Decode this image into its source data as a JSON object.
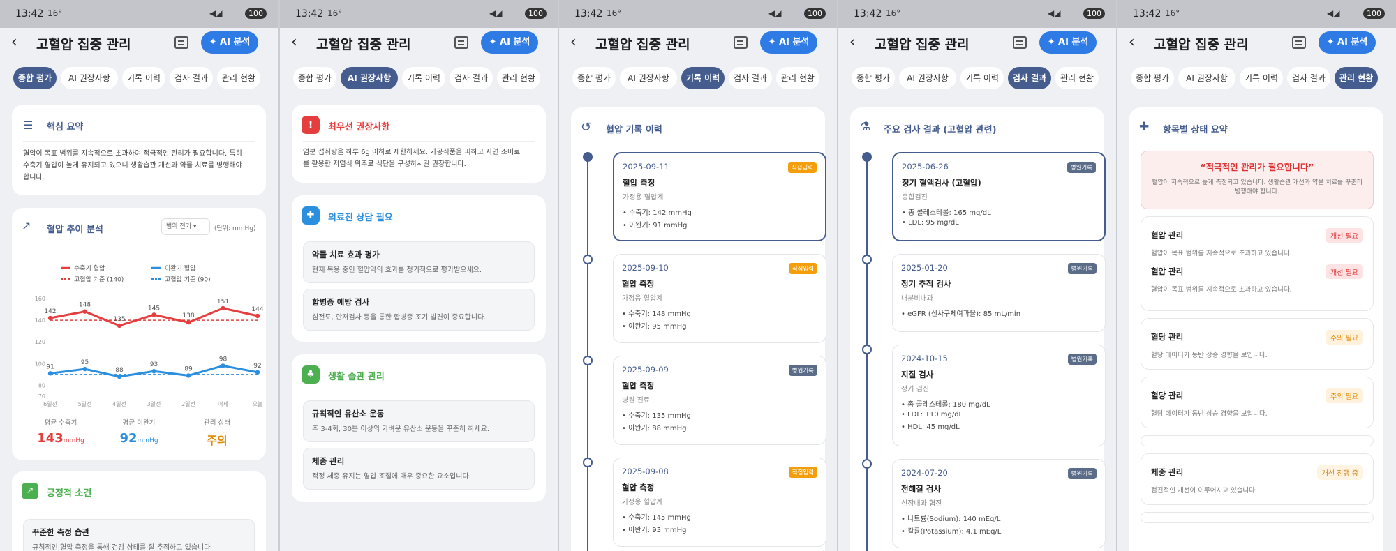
{
  "status": {
    "time": "13:42",
    "temp": "16°",
    "battery": "100"
  },
  "app": {
    "title": "고혈압 집중 관리",
    "ai_button": "AI 분석"
  },
  "tabs": [
    "종합 평가",
    "AI 권장사항",
    "기록 이력",
    "검사 결과",
    "관리 현황"
  ],
  "colors": {
    "primary": "#445c8e",
    "accent": "#2f7be6",
    "red": "#e53e3e",
    "blue": "#2b8fe0",
    "orange": "#e08a00",
    "green": "#4caf50"
  },
  "screen1": {
    "summary_title": "핵심 요약",
    "summary_text": [
      "혈압이 목표 범위를 지속적으로 초과하여 적극적인 관리가 필요합니다. 특히",
      "수축기 혈압이 높게 유지되고 있으니 생활습관 개선과 약물 치료를 병행해야",
      "합니다."
    ],
    "trend_title": "혈압 추이 분석",
    "range_select": "범위 전기",
    "unit_label": "(단위: mmHg)",
    "legend": {
      "sys": "수축기 혈압",
      "dia": "이완기 혈압",
      "sys_ref": "고혈압 기준 (140)",
      "dia_ref": "고혈압 기준 (90)"
    },
    "stats": [
      {
        "label": "평균 수축기",
        "value": "143",
        "unit": "mmHg"
      },
      {
        "label": "평균 이완기",
        "value": "92",
        "unit": "mmHg"
      },
      {
        "label": "관리 상태",
        "value": "주의",
        "unit": ""
      }
    ],
    "positive_title": "긍정적 소견",
    "positive_item_title": "꾸준한 측정 습관",
    "positive_item_desc": "규칙적인 혈압 측정을 통해 건강 상태를 잘 추적하고 있습니다"
  },
  "chart_data": {
    "type": "line",
    "categories": [
      "6일전",
      "5일전",
      "4일전",
      "3일전",
      "2일전",
      "어제",
      "오늘"
    ],
    "series": [
      {
        "name": "수축기 혈압",
        "values": [
          142,
          148,
          135,
          145,
          138,
          151,
          144
        ],
        "color": "#e53e3e"
      },
      {
        "name": "이완기 혈압",
        "values": [
          91,
          95,
          88,
          93,
          89,
          98,
          92
        ],
        "color": "#2b8fe0"
      }
    ],
    "reference_lines": [
      {
        "name": "고혈압 기준 (140)",
        "value": 140
      },
      {
        "name": "고혈압 기준 (90)",
        "value": 90
      }
    ],
    "yticks": [
      160,
      140,
      120,
      100,
      80,
      70
    ],
    "ylim": [
      70,
      160
    ],
    "legend_position": "top"
  },
  "screen2": {
    "priority_title": "최우선 권장사항",
    "priority_text": [
      "염분 섭취량을 하루 6g 이하로 제한하세요. 가공식품을 피하고 자연 조미료",
      "를 활용한 저염식 위주로 식단을 구성하시길 권장합니다."
    ],
    "consult_title": "의료진 상담 필요",
    "consult_items": [
      {
        "title": "약물 치료 효과 평가",
        "desc": "현재 복용 중인 혈압약의 효과를 정기적으로 평가받으세요."
      },
      {
        "title": "합병증 예방 검사",
        "desc": "심전도, 안저검사 등을 통한 합병증 조기 발견이 중요합니다."
      }
    ],
    "life_title": "생활 습관 관리",
    "life_items": [
      {
        "title": "규칙적인 유산소 운동",
        "desc": "주 3-4회, 30분 이상의 가벼운 유산소 운동을 꾸준히 하세요."
      },
      {
        "title": "체중 관리",
        "desc": "적정 체중 유지는 혈압 조절에 매우 중요한 요소입니다."
      }
    ]
  },
  "screen3": {
    "title": "혈압 기록 이력",
    "records": [
      {
        "date": "2025-09-11",
        "badge": "직접입력",
        "title": "혈압 측정",
        "sub": "가정용 혈압계",
        "l1": "수축기: 142 mmHg",
        "l2": "이완기: 91 mmHg"
      },
      {
        "date": "2025-09-10",
        "badge": "직접입력",
        "title": "혈압 측정",
        "sub": "가정용 혈압계",
        "l1": "수축기: 148 mmHg",
        "l2": "이완기: 95 mmHg"
      },
      {
        "date": "2025-09-09",
        "badge": "병원기록",
        "title": "혈압 측정",
        "sub": "병원 진료",
        "l1": "수축기: 135 mmHg",
        "l2": "이완기: 88 mmHg"
      },
      {
        "date": "2025-09-08",
        "badge": "직접입력",
        "title": "혈압 측정",
        "sub": "가정용 혈압계",
        "l1": "수축기: 145 mmHg",
        "l2": "이완기: 93 mmHg"
      }
    ]
  },
  "screen4": {
    "title": "주요 검사 결과 (고혈압 관련)",
    "records": [
      {
        "date": "2025-06-26",
        "badge": "병원기록",
        "title": "정기 혈액검사 (고혈압)",
        "sub": "종합검진",
        "l1": "총 콜레스테롤: 165 mg/dL",
        "l2": "LDL: 95 mg/dL",
        "l3": ""
      },
      {
        "date": "2025-01-20",
        "badge": "병원기록",
        "title": "정기 추적 검사",
        "sub": "내분비내과",
        "l1": "eGFR (신사구체여과율): 85 mL/min",
        "l2": "",
        "l3": ""
      },
      {
        "date": "2024-10-15",
        "badge": "병원기록",
        "title": "지질 검사",
        "sub": "정기 검진",
        "l1": "총 콜레스테롤: 180 mg/dL",
        "l2": "LDL: 110 mg/dL",
        "l3": "HDL: 45 mg/dL"
      },
      {
        "date": "2024-07-20",
        "badge": "병원기록",
        "title": "전해질 검사",
        "sub": "신장내과 협진",
        "l1": "나트륨(Sodium): 140 mEq/L",
        "l2": "칼륨(Potassium): 4.1 mEq/L",
        "l3": ""
      }
    ]
  },
  "screen5": {
    "title": "항목별 상태 요약",
    "alert_title": "“적극적인 관리가 필요합니다”",
    "alert_text": [
      "혈압이 지속적으로 높게 측정되고 있습니다. 생활습관 개선과 약물 치료를 꾸준히",
      "병행해야 합니다."
    ],
    "items": [
      {
        "title": "혈압 관리",
        "desc": "혈압이 목표 범위를 지속적으로 초과하고 있습니다.",
        "badge": "개선 필요"
      },
      {
        "title": "혈압 관리",
        "desc": "혈압이 목표 범위를 지속적으로 초과하고 있습니다.",
        "badge": "개선 필요"
      },
      {
        "title": "혈당 관리",
        "desc": "혈당 데이터가 동반 상승 경향을 보입니다.",
        "badge": "주의 필요"
      },
      {
        "title": "혈당 관리",
        "desc": "혈당 데이터가 동반 상승 경향을 보입니다.",
        "badge": "주의 필요"
      },
      {
        "title": "체중 관리",
        "desc": "점진적인 개선이 이루어지고 있습니다.",
        "badge": "개선 진행 중"
      }
    ]
  }
}
